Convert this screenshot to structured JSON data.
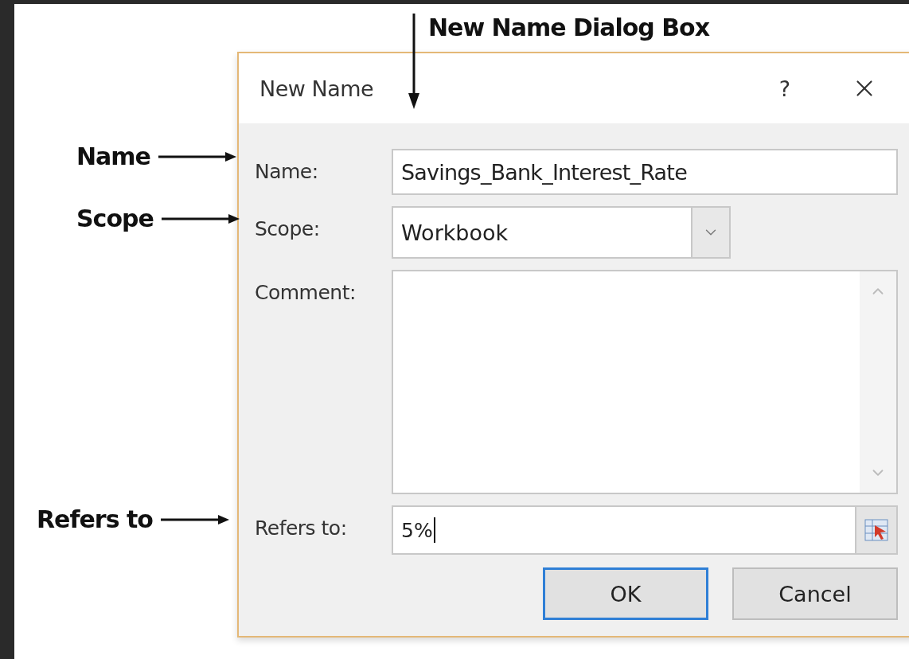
{
  "annotations": [
    {
      "kind": "top",
      "text": "New Name Dialog Box"
    },
    {
      "kind": "side",
      "text": "Name"
    },
    {
      "kind": "side",
      "text": "Scope"
    },
    {
      "kind": "side",
      "text": "Refers to"
    }
  ],
  "dialog": {
    "title": "New Name",
    "help": "?",
    "fields": [
      {
        "kind": "text",
        "label": "Name:",
        "value": "Savings_Bank_Interest_Rate"
      },
      {
        "kind": "select",
        "label": "Scope:",
        "value": "Workbook"
      },
      {
        "kind": "textarea",
        "label": "Comment:"
      },
      {
        "kind": "reference",
        "label": "Refers to:",
        "value": "5%"
      }
    ],
    "buttons": [
      {
        "label": "OK",
        "default": true
      },
      {
        "label": "Cancel",
        "default": false
      }
    ]
  }
}
